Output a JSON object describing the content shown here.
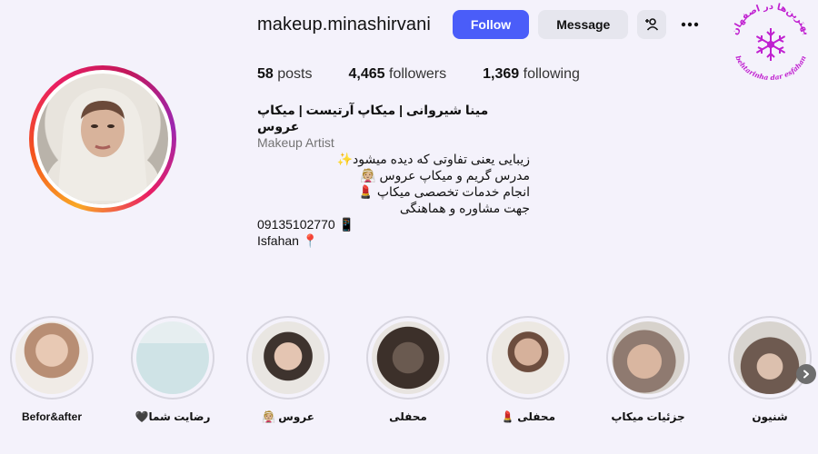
{
  "profile": {
    "username": "makeup.minashirvani",
    "follow_label": "Follow",
    "message_label": "Message",
    "stats": {
      "posts_count": "58",
      "posts_label": "posts",
      "followers_count": "4,465",
      "followers_label": "followers",
      "following_count": "1,369",
      "following_label": "following"
    },
    "bio": {
      "name": "مینا شیروانی | میکاپ آرتیست | میکاپ عروس",
      "category": "Makeup Artist",
      "lines": [
        "زیبایی یعنی تفاوتی که دیده میشود✨",
        "مدرس گریم و میکاپ عروس 👰🏼",
        "انجام خدمات تخصصی میکاپ 💄",
        "جهت مشاوره و هماهنگی",
        "09135102770 📱",
        "Isfahan 📍"
      ]
    }
  },
  "watermark": {
    "top_text": "بهترین‌ها در اصفهان",
    "bottom_text": "behtarinha dar esfahan"
  },
  "highlights": [
    {
      "label": "Befor&after",
      "color": "#c9a48c"
    },
    {
      "label": "رضایت شما🖤",
      "color": "#cfe3e6"
    },
    {
      "label": "عروس 👰🏼",
      "color": "#8a7f78"
    },
    {
      "label": "محفلی",
      "color": "#5e5048"
    },
    {
      "label": "محفلی 💄",
      "color": "#cfb8a9"
    },
    {
      "label": "جزئیات میکاپ",
      "color": "#9c8a82"
    },
    {
      "label": "شنیون",
      "color": "#7d6b62"
    }
  ],
  "colors": {
    "follow_button": "#4a5df9",
    "background": "#f4f2fb",
    "watermark": "#c020d0"
  }
}
